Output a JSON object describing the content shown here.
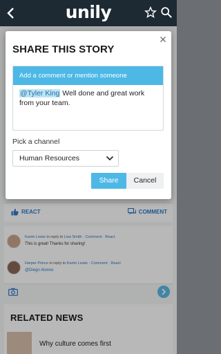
{
  "app": {
    "logo": "unily"
  },
  "colors": {
    "accent": "#4db8e6",
    "link": "#2b79c9",
    "appbar": "#1e2a33"
  },
  "icons": {
    "back": "chevron-left-icon",
    "favorite": "star-icon",
    "search": "search-icon",
    "close": "close-icon",
    "react": "thumbs-up-icon",
    "comment": "comment-icon",
    "camera": "camera-icon",
    "send": "send-icon",
    "dropdown": "chevron-down-icon"
  },
  "modal": {
    "title": "SHARE THIS STORY",
    "composer_placeholder": "Add a comment or mention someone",
    "mention": "@Tyler King",
    "message_rest": " Well done and great work from your team.",
    "channel_label": "Pick a channel",
    "channel_value": "Human Resources",
    "share_label": "Share",
    "cancel_label": "Cancel"
  },
  "background": {
    "react_label": "REACT",
    "comment_label": "COMMENT",
    "comments": [
      {
        "author": "Karim Lewis",
        "reply_text": "in reply to",
        "reply_to": "Lisa Smith",
        "comment_action": "Comment",
        "react_action": "React",
        "text": "This is great! Thanks for sharing!"
      },
      {
        "author": "Harper Prince",
        "reply_text": "in reply to",
        "reply_to": "Karim Lewis",
        "comment_action": "Comment",
        "react_action": "React",
        "text": "@Diego Alonso"
      }
    ],
    "related_title": "RELATED NEWS",
    "related_item": "Why culture comes first"
  }
}
